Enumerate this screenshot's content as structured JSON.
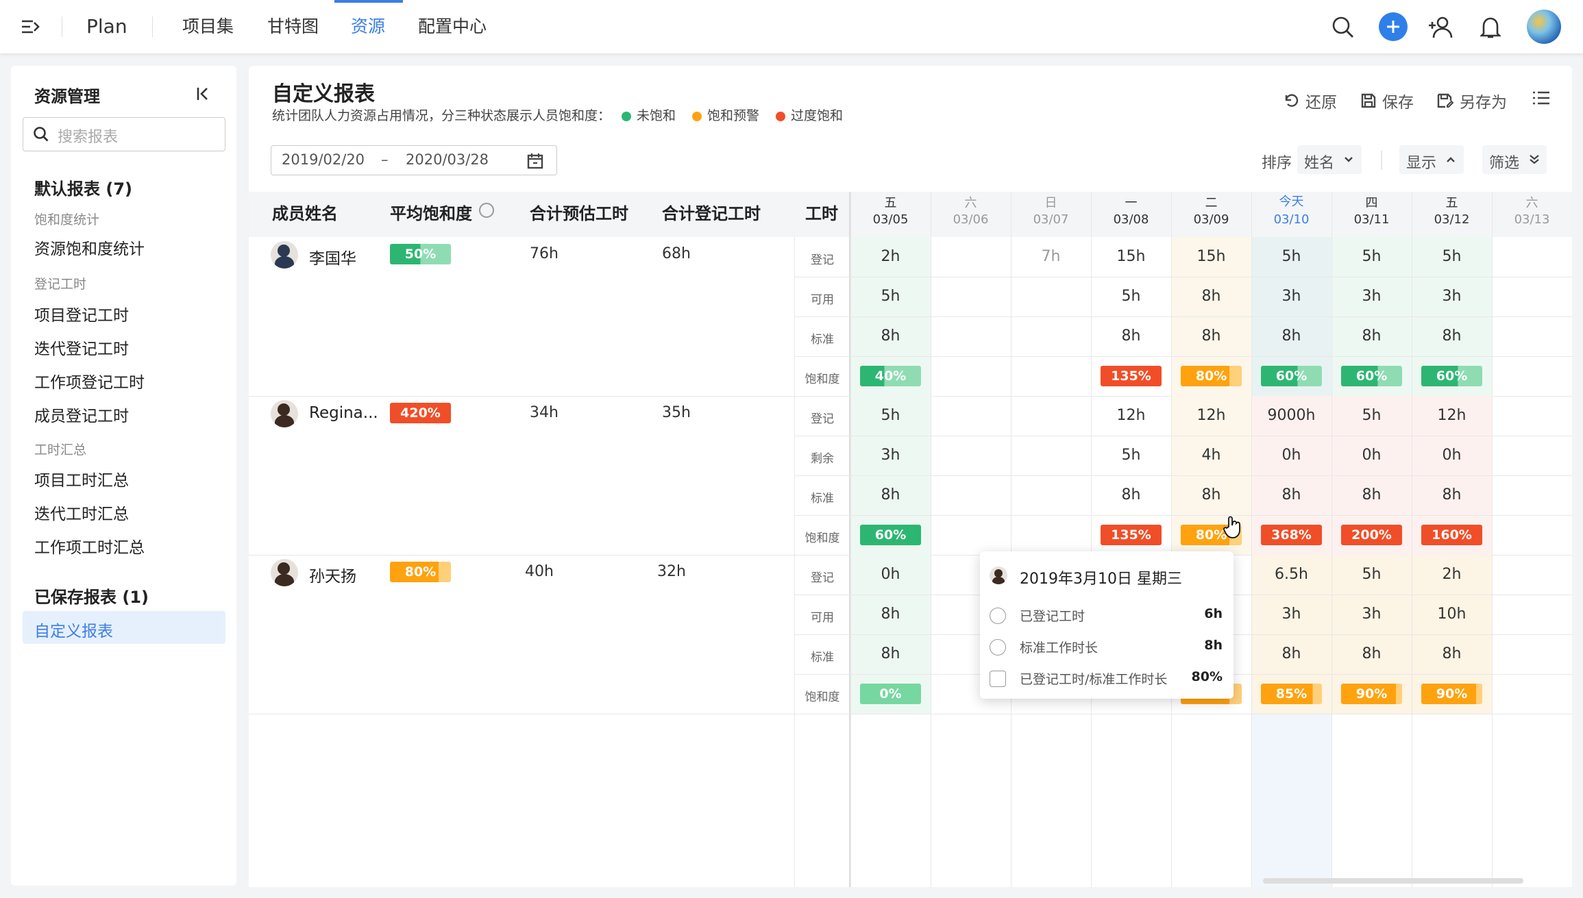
{
  "app": {
    "title": "Plan"
  },
  "nav": {
    "tabs": [
      {
        "label": "项目集"
      },
      {
        "label": "甘特图"
      },
      {
        "label": "资源"
      },
      {
        "label": "配置中心"
      }
    ],
    "active_index": 2
  },
  "colors": {
    "accent": "#3c7ee6",
    "unsaturated": "#2db672",
    "warning": "#ffa20f",
    "oversaturated": "#f04e28"
  },
  "icons": [
    "menu-collapse-icon",
    "search-icon",
    "plus-circle-icon",
    "add-user-icon",
    "bell-icon",
    "avatar"
  ],
  "sidebar": {
    "title": "资源管理",
    "search_placeholder": "搜索报表",
    "default_group": "默认报表 (7)",
    "sections": [
      {
        "title": "饱和度统计",
        "items": [
          "资源饱和度统计"
        ]
      },
      {
        "title": "登记工时",
        "items": [
          "项目登记工时",
          "迭代登记工时",
          "工作项登记工时",
          "成员登记工时"
        ]
      },
      {
        "title": "工时汇总",
        "items": [
          "项目工时汇总",
          "迭代工时汇总",
          "工作项工时汇总"
        ]
      }
    ],
    "saved_group": "已保存报表 (1)",
    "saved_items": [
      "自定义报表"
    ]
  },
  "report": {
    "title": "自定义报表",
    "description": "统计团队人力资源占用情况，分三种状态展示人员饱和度：",
    "legend": [
      "未饱和",
      "饱和预警",
      "过度饱和"
    ],
    "actions": {
      "restore": "还原",
      "save": "保存",
      "save_as": "另存为"
    },
    "date_start": "2019/02/20",
    "date_sep": "–",
    "date_end": "2020/03/28",
    "sort_label": "排序",
    "sort_value": "姓名",
    "display_label": "显示",
    "filter_label": "筛选"
  },
  "table": {
    "columns": [
      "成员姓名",
      "平均饱和度",
      "合计预估工时",
      "合计登记工时",
      "工时"
    ],
    "days": [
      {
        "weekday": "五",
        "date": "03/05"
      },
      {
        "weekday": "六",
        "date": "03/06"
      },
      {
        "weekday": "日",
        "date": "03/07"
      },
      {
        "weekday": "一",
        "date": "03/08"
      },
      {
        "weekday": "二",
        "date": "03/09"
      },
      {
        "weekday": "今天",
        "date": "03/10"
      },
      {
        "weekday": "四",
        "date": "03/11"
      },
      {
        "weekday": "五",
        "date": "03/12"
      },
      {
        "weekday": "六",
        "date": "03/13"
      }
    ],
    "members": [
      {
        "name": "李国华",
        "avg": "50%",
        "avg_level": "green",
        "estimate": "76h",
        "logged": "68h",
        "rows": [
          {
            "label": "登记",
            "cells": [
              "2h",
              "",
              "7h",
              "15h",
              "15h",
              "5h",
              "5h",
              "5h",
              ""
            ]
          },
          {
            "label": "可用",
            "cells": [
              "5h",
              "",
              "",
              "5h",
              "8h",
              "3h",
              "3h",
              "3h",
              ""
            ]
          },
          {
            "label": "标准",
            "cells": [
              "8h",
              "",
              "",
              "8h",
              "8h",
              "8h",
              "8h",
              "8h",
              ""
            ]
          },
          {
            "label": "饱和度",
            "badges": [
              {
                "v": "40%",
                "c": "green",
                "f": 0.4
              },
              null,
              null,
              {
                "v": "135%",
                "c": "red",
                "f": 1
              },
              {
                "v": "80%",
                "c": "orange",
                "f": 0.8
              },
              {
                "v": "60%",
                "c": "green",
                "f": 0.6
              },
              {
                "v": "60%",
                "c": "green",
                "f": 0.6
              },
              {
                "v": "60%",
                "c": "green",
                "f": 0.6
              },
              null
            ]
          }
        ]
      },
      {
        "name": "Regina...",
        "avg": "420%",
        "avg_level": "red",
        "estimate": "34h",
        "logged": "35h",
        "rows": [
          {
            "label": "登记",
            "cells": [
              "5h",
              "",
              "",
              "12h",
              "12h",
              "9000h",
              "5h",
              "12h",
              ""
            ]
          },
          {
            "label": "剩余",
            "cells": [
              "3h",
              "",
              "",
              "5h",
              "4h",
              "0h",
              "0h",
              "0h",
              ""
            ]
          },
          {
            "label": "标准",
            "cells": [
              "8h",
              "",
              "",
              "8h",
              "8h",
              "8h",
              "8h",
              "8h",
              ""
            ]
          },
          {
            "label": "饱和度",
            "badges": [
              {
                "v": "60%",
                "c": "green",
                "f": 1
              },
              null,
              null,
              {
                "v": "135%",
                "c": "red",
                "f": 1
              },
              {
                "v": "80%",
                "c": "orange",
                "f": 0.8
              },
              {
                "v": "368%",
                "c": "red",
                "f": 1
              },
              {
                "v": "200%",
                "c": "red",
                "f": 1
              },
              {
                "v": "160%",
                "c": "red",
                "f": 1
              },
              null
            ]
          }
        ]
      },
      {
        "name": "孙天扬",
        "avg": "80%",
        "avg_level": "orange",
        "estimate": "40h",
        "logged": "32h",
        "rows": [
          {
            "label": "登记",
            "cells": [
              "0h",
              "",
              "",
              "",
              "",
              "6.5h",
              "5h",
              "2h",
              ""
            ]
          },
          {
            "label": "可用",
            "cells": [
              "8h",
              "",
              "",
              "",
              "",
              "3h",
              "3h",
              "10h",
              ""
            ]
          },
          {
            "label": "标准",
            "cells": [
              "8h",
              "",
              "",
              "",
              "",
              "8h",
              "8h",
              "8h",
              ""
            ]
          },
          {
            "label": "饱和度",
            "badges": [
              {
                "v": "0%",
                "c": "lgreen",
                "f": 1
              },
              null,
              null,
              null,
              {
                "v": "",
                "c": "orange",
                "f": 0.8
              },
              {
                "v": "85%",
                "c": "orange",
                "f": 0.85
              },
              {
                "v": "90%",
                "c": "orange",
                "f": 0.9
              },
              {
                "v": "90%",
                "c": "orange",
                "f": 0.9
              },
              null
            ]
          }
        ]
      }
    ]
  },
  "tooltip": {
    "date": "2019年3月10日 星期三",
    "rows": [
      {
        "icon": "clock-plus-icon",
        "label": "已登记工时",
        "value": "6h"
      },
      {
        "icon": "timer-icon",
        "label": "标准工作时长",
        "value": "8h"
      },
      {
        "icon": "percent-icon",
        "label": "已登记工时/标准工作时长",
        "value": "80%"
      }
    ]
  }
}
